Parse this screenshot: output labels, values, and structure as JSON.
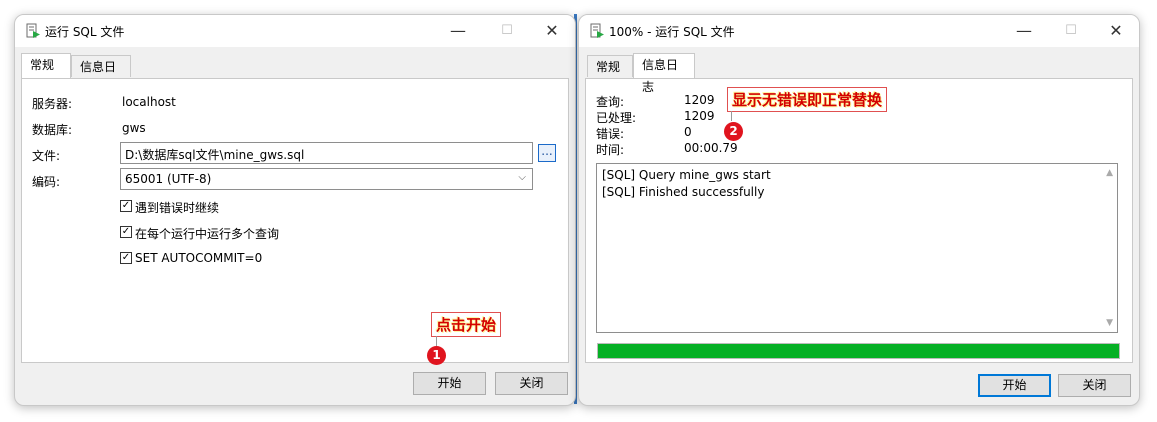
{
  "left_window": {
    "title": "运行 SQL 文件",
    "tabs": [
      {
        "label": "常规",
        "active": true
      },
      {
        "label": "信息日志",
        "active": false
      }
    ],
    "fields": {
      "server_label": "服务器:",
      "server_value": "localhost",
      "database_label": "数据库:",
      "database_value": "gws",
      "file_label": "文件:",
      "file_value": "D:\\数据库sql文件\\mine_gws.sql",
      "browse_label": "...",
      "encoding_label": "编码:",
      "encoding_value": "65001 (UTF-8)"
    },
    "options": [
      {
        "label": "遇到错误时继续",
        "checked": true
      },
      {
        "label": "在每个运行中运行多个查询",
        "checked": true
      },
      {
        "label": "SET AUTOCOMMIT=0",
        "checked": true
      }
    ],
    "start_button": "开始",
    "close_button": "关闭",
    "annotation": {
      "text": "点击开始",
      "step": "1"
    }
  },
  "right_window": {
    "title": "100% - 运行 SQL 文件",
    "tabs": [
      {
        "label": "常规",
        "active": false
      },
      {
        "label": "信息日志",
        "active": true
      }
    ],
    "stats": {
      "query_label": "查询:",
      "query_value": "1209",
      "processed_label": "已处理:",
      "processed_value": "1209",
      "errors_label": "错误:",
      "errors_value": "0",
      "time_label": "时间:",
      "time_value": "00:00.79"
    },
    "log_lines": [
      "[SQL] Query mine_gws start",
      "[SQL] Finished successfully"
    ],
    "progress": 1.0,
    "start_button": "开始",
    "close_button": "关闭",
    "annotation": {
      "text": "显示无错误即正常替换",
      "step": "2"
    }
  },
  "window_controls": {
    "minimize": "—",
    "maximize": "☐",
    "close": "✕"
  },
  "colors": {
    "progress": "#06b025",
    "badge": "#e0141e",
    "annotation_text": "#d40000",
    "divider": "#3c7bc5"
  }
}
